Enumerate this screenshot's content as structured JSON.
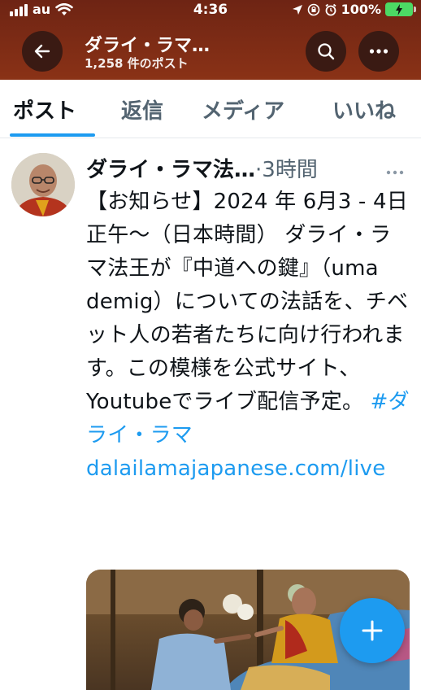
{
  "status_bar": {
    "carrier": "au",
    "time": "4:36",
    "battery_percent": "100%"
  },
  "nav": {
    "title": "ダライ・ラマ…",
    "post_count": "1,258 件のポスト"
  },
  "tabs": [
    {
      "label": "ポスト",
      "active": true
    },
    {
      "label": "返信",
      "active": false
    },
    {
      "label": "メディア",
      "active": false
    },
    {
      "label": "いいね",
      "active": false
    }
  ],
  "tweet": {
    "author": "ダライ・ラマ法…",
    "separator": "·",
    "time": "3時間",
    "text": "【お知らせ】2024 年 6月3 - 4日 正午〜（日本時間） ダライ・ラマ法王が『中道への鍵』（uma demig）についての法話を、チベット人の若者たちに向け行われます。この模様を公式サイト、Youtubeでライブ配信予定。",
    "hashtag": "#ダライ・ラマ",
    "link": "dalailamajapanese.com/live"
  },
  "colors": {
    "header_bg": "#7a2a15",
    "accent": "#1d9bf0",
    "text_primary": "#0f1419",
    "text_secondary": "#536471"
  },
  "icons": {
    "back": "arrow-left-icon",
    "search": "search-icon",
    "more": "more-horizontal-icon",
    "compose": "plus-icon"
  }
}
